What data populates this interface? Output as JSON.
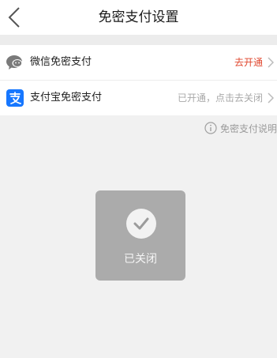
{
  "header": {
    "title": "免密支付设置",
    "back_icon": "chevron-left-icon"
  },
  "rows": [
    {
      "icon": "wechat-icon",
      "label": "微信免密支付",
      "status": "去开通",
      "status_color": "#e0472e"
    },
    {
      "icon": "alipay-icon",
      "label": "支付宝免密支付",
      "status": "已开通，点击去关闭",
      "status_color": "#a8a8a8"
    }
  ],
  "help": {
    "icon": "info-circle-icon",
    "label": "免密支付说明"
  },
  "toast": {
    "icon": "check-circle-icon",
    "text": "已关闭"
  },
  "colors": {
    "background": "#f1f1f1",
    "alipay_blue": "#1677ff",
    "toast_bg": "#ababab"
  }
}
